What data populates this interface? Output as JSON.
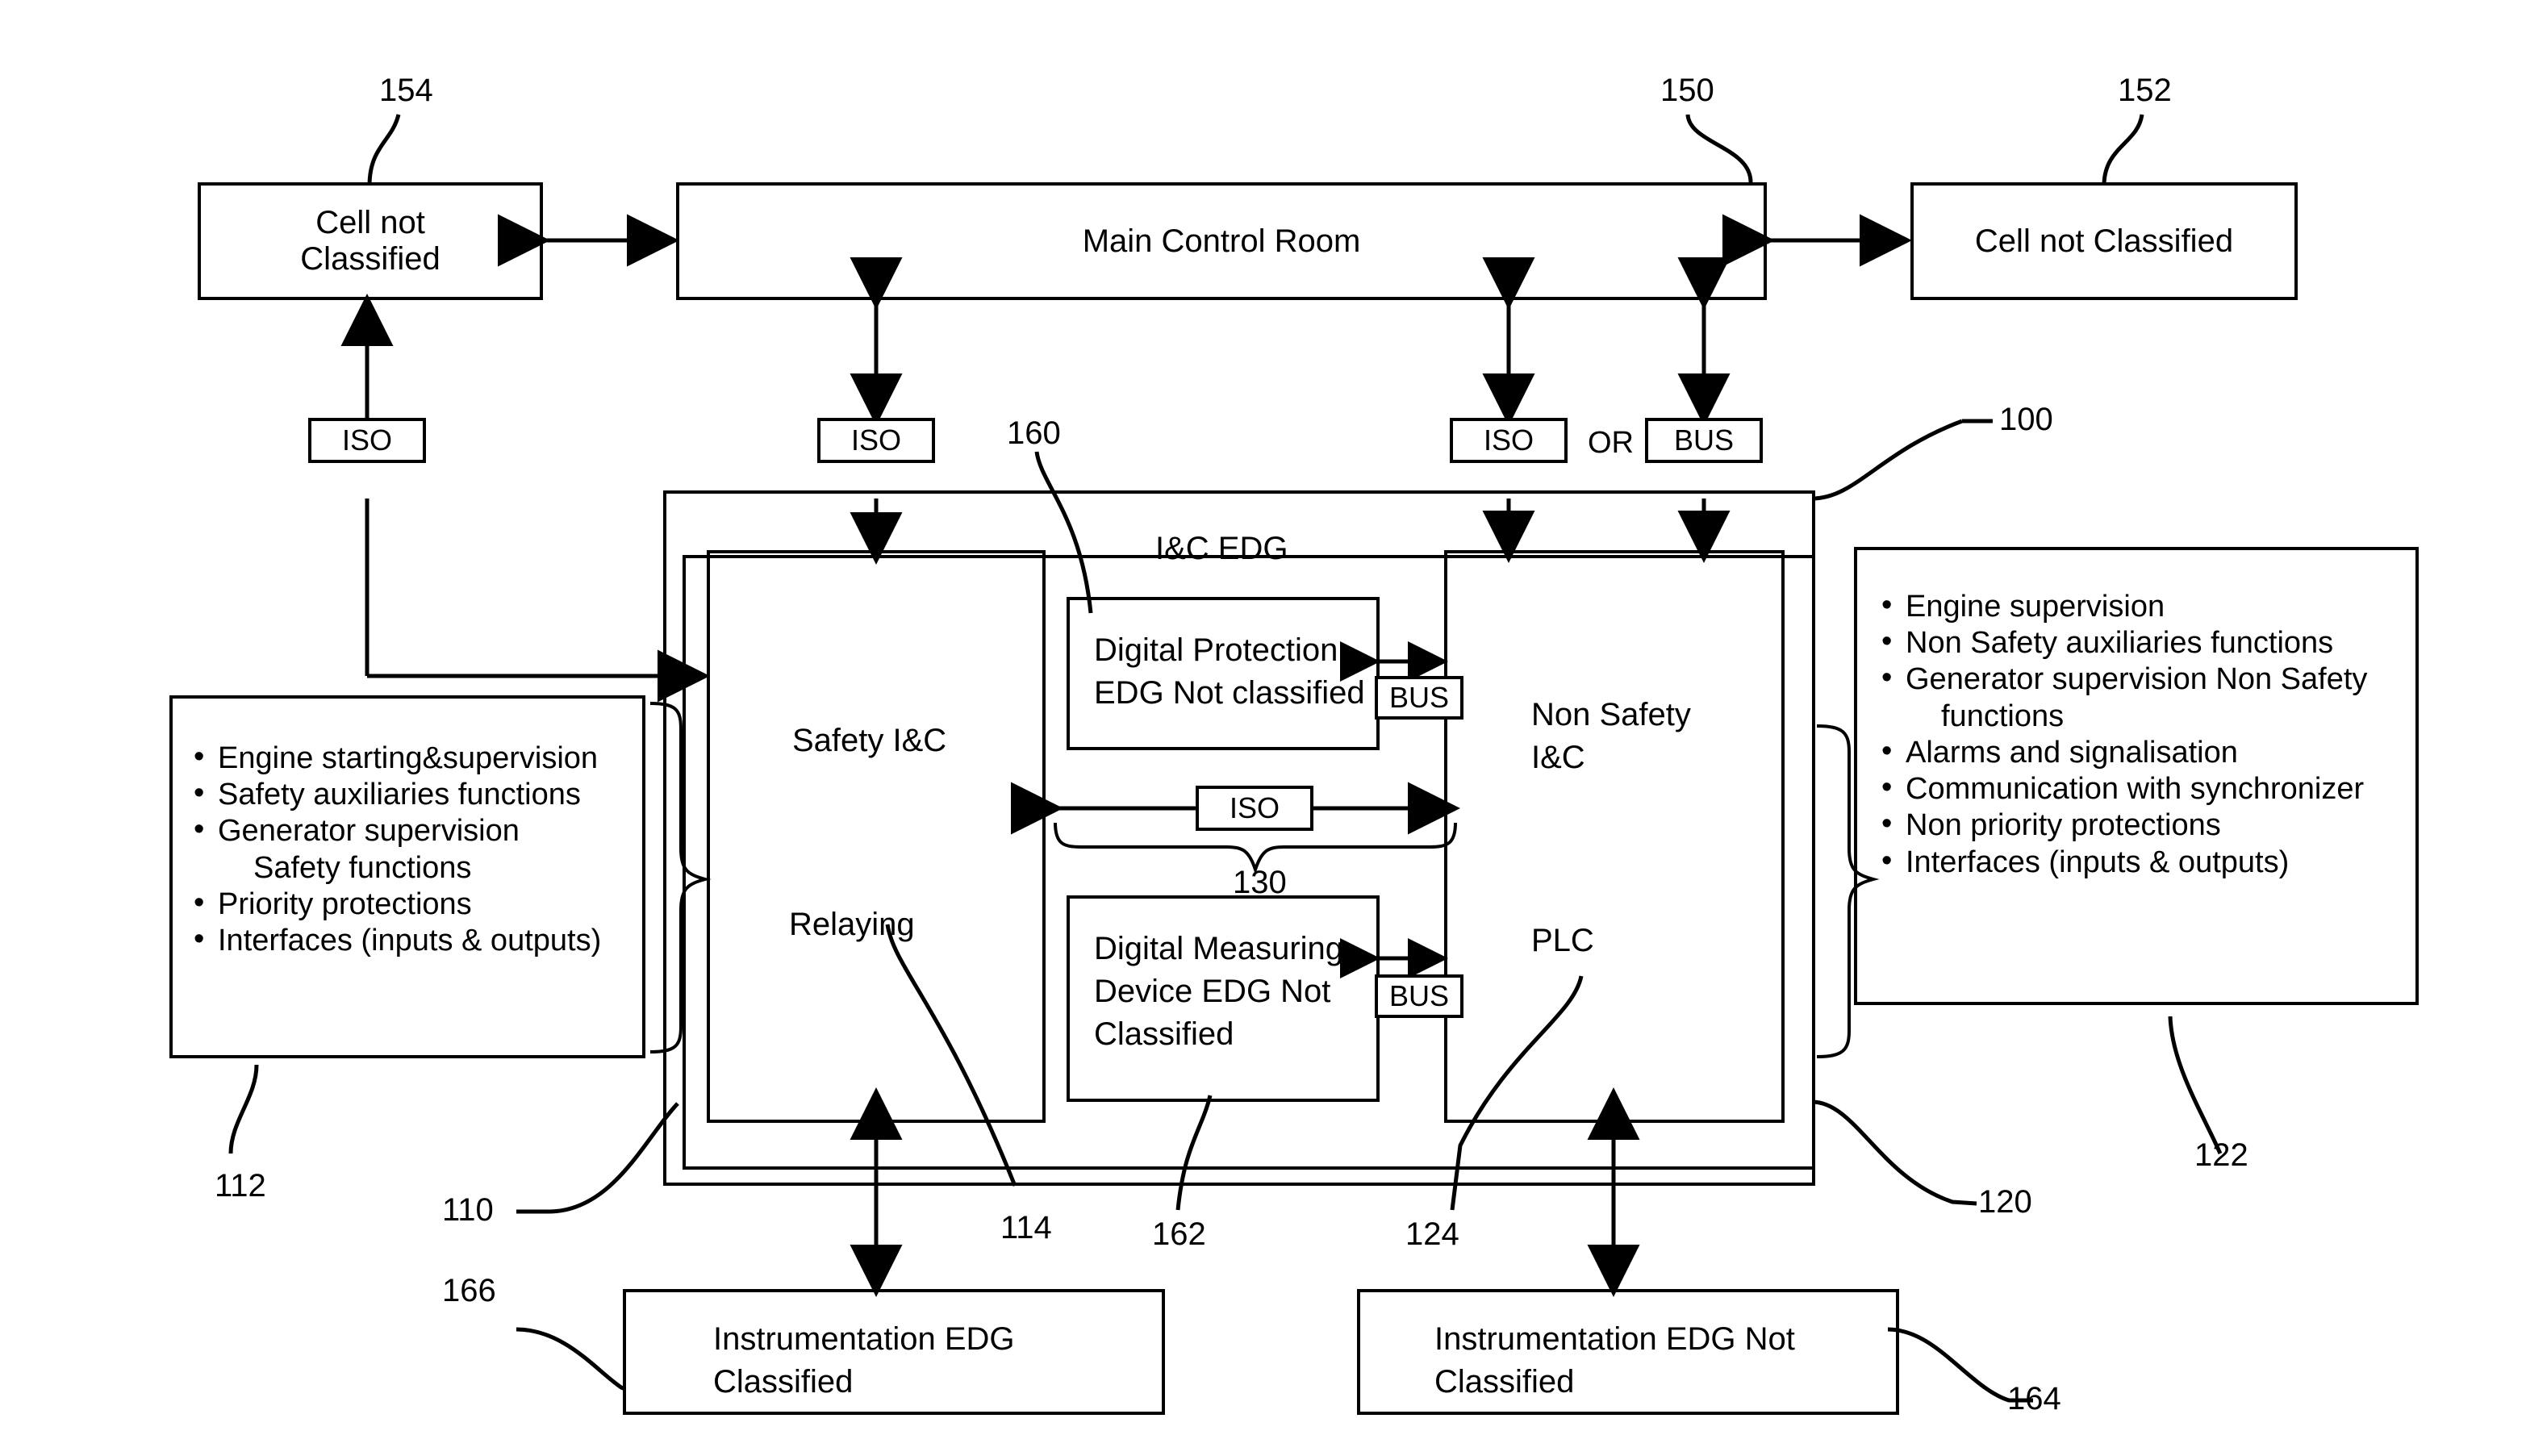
{
  "diagram": {
    "title_reference": "100",
    "system_label": "I&C EDG"
  },
  "top_row": {
    "left_cell": {
      "label": "Cell not\nClassified",
      "ref": "154"
    },
    "main_control_room": {
      "label": "Main Control Room",
      "ref": "150"
    },
    "right_cell": {
      "label": "Cell not Classified",
      "ref": "152"
    }
  },
  "connectors": {
    "iso_left": "ISO",
    "iso_center": "ISO",
    "iso_right": "ISO",
    "or_label": "OR",
    "bus_right": "BUS",
    "bus_protection": "BUS",
    "bus_measuring": "BUS",
    "iso_middle": "ISO",
    "iso_middle_ref": "130"
  },
  "blocks": {
    "safety_ic": {
      "label": "Safety I&C",
      "sublabel": "Relaying",
      "ref": "110",
      "sub_ref": "114"
    },
    "non_safety_ic": {
      "label": "Non Safety\nI&C",
      "sublabel": "PLC",
      "ref": "120",
      "sub_ref": "124"
    },
    "digital_protection": {
      "label": "Digital Protection\nEDG Not classified",
      "ref": "160"
    },
    "digital_measuring": {
      "label": "Digital Measuring\nDevice EDG Not\nClassified",
      "ref": "162"
    },
    "instrumentation_classified": {
      "label": "Instrumentation EDG\nClassified",
      "ref": "166"
    },
    "instrumentation_not_classified": {
      "label": "Instrumentation EDG Not\nClassified",
      "ref": "164"
    }
  },
  "left_functions": {
    "ref": "112",
    "items": [
      {
        "text": "Engine starting&supervision",
        "continuation": false
      },
      {
        "text": "Safety auxiliaries functions",
        "continuation": false
      },
      {
        "text": "Generator supervision",
        "continuation": false
      },
      {
        "text": "Safety functions",
        "continuation": true
      },
      {
        "text": "Priority protections",
        "continuation": false
      },
      {
        "text": "Interfaces (inputs & outputs)",
        "continuation": false
      }
    ]
  },
  "right_functions": {
    "ref": "122",
    "items": [
      {
        "text": "Engine supervision",
        "continuation": false
      },
      {
        "text": "Non Safety auxiliaries functions",
        "continuation": false
      },
      {
        "text": "Generator supervision Non Safety",
        "continuation": false
      },
      {
        "text": "functions",
        "continuation": true
      },
      {
        "text": "Alarms and signalisation",
        "continuation": false
      },
      {
        "text": "Communication with synchronizer",
        "continuation": false
      },
      {
        "text": "Non priority protections",
        "continuation": false
      },
      {
        "text": "Interfaces (inputs & outputs)",
        "continuation": false
      }
    ]
  },
  "colors": {
    "stroke": "#000000",
    "background": "#ffffff"
  }
}
